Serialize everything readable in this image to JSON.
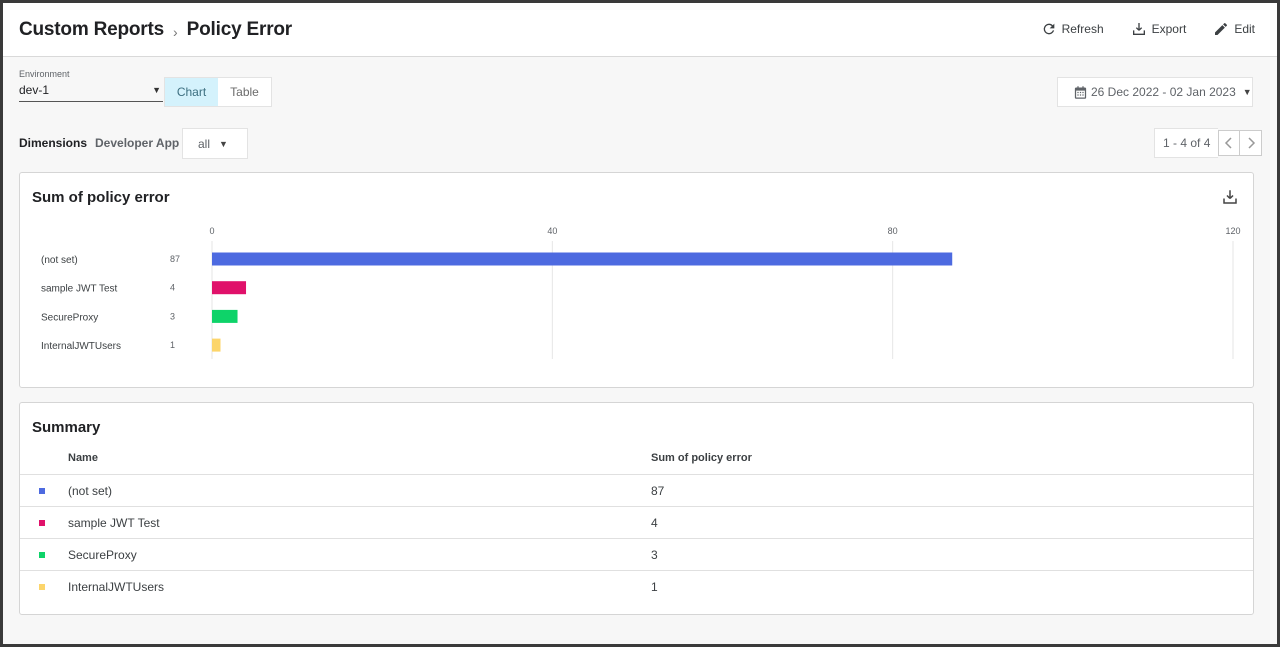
{
  "breadcrumb": {
    "parent": "Custom Reports",
    "current": "Policy Error"
  },
  "actions": {
    "refresh": "Refresh",
    "export": "Export",
    "edit": "Edit"
  },
  "environment": {
    "label": "Environment",
    "value": "dev-1"
  },
  "view_toggle": {
    "chart": "Chart",
    "table": "Table",
    "active": "Chart"
  },
  "date_range": "26 Dec 2022 - 02 Jan 2023",
  "dimensions": {
    "label": "Dimensions",
    "developer_app_label": "Developer App",
    "developer_app_value": "all"
  },
  "pagination": {
    "text": "1 - 4 of 4"
  },
  "chart_data": {
    "type": "bar",
    "orientation": "horizontal",
    "title": "Sum of policy error",
    "categories": [
      "(not set)",
      "sample JWT Test",
      "SecureProxy",
      "InternalJWTUsers"
    ],
    "values": [
      87,
      4,
      3,
      1
    ],
    "colors": [
      "#4d6ae0",
      "#e0116a",
      "#0ed369",
      "#fcd56b"
    ],
    "xlim": [
      0,
      120
    ],
    "xticks": [
      0,
      40,
      80,
      120
    ],
    "grid": true
  },
  "summary": {
    "title": "Summary",
    "columns": {
      "name": "Name",
      "value": "Sum of policy error"
    },
    "rows": [
      {
        "name": "(not set)",
        "value": "87",
        "color": "#4d6ae0"
      },
      {
        "name": "sample JWT Test",
        "value": "4",
        "color": "#e0116a"
      },
      {
        "name": "SecureProxy",
        "value": "3",
        "color": "#0ed369"
      },
      {
        "name": "InternalJWTUsers",
        "value": "1",
        "color": "#fcd56b"
      }
    ]
  }
}
